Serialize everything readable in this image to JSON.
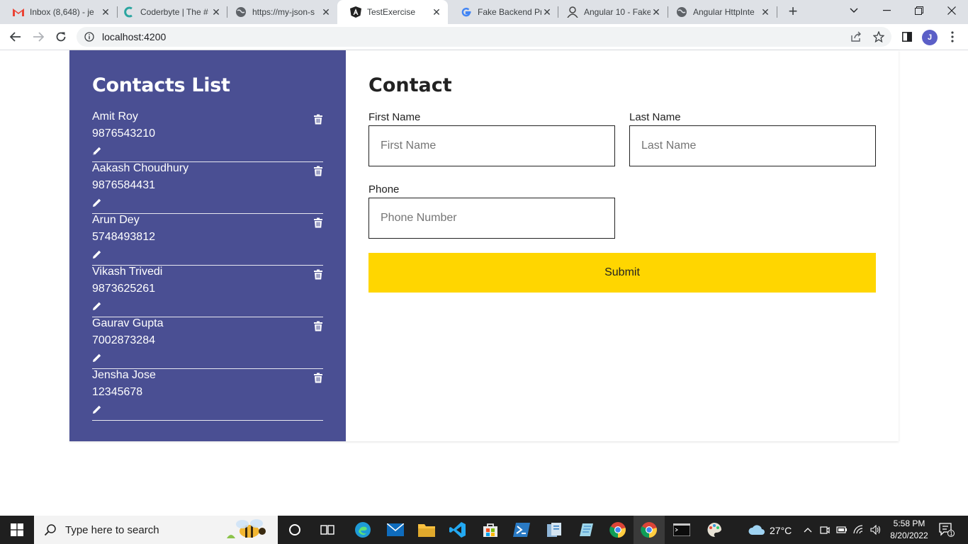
{
  "browser": {
    "tabs": [
      {
        "title": "Inbox (8,648) - je",
        "icon": "gmail-icon",
        "active": false
      },
      {
        "title": "Coderbyte | The #",
        "icon": "coderbyte-icon",
        "active": false
      },
      {
        "title": "https://my-json-s",
        "icon": "globe-icon",
        "active": false
      },
      {
        "title": "TestExercise",
        "icon": "angular-icon",
        "active": true
      },
      {
        "title": "Fake Backend Pro",
        "icon": "google-icon",
        "active": false
      },
      {
        "title": "Angular 10 - Fake",
        "icon": "avatar-icon",
        "active": false
      },
      {
        "title": "Angular HttpInte",
        "icon": "globe-icon",
        "active": false
      }
    ],
    "url": "localhost:4200",
    "profile_initial": "J"
  },
  "sidebar": {
    "title": "Contacts List",
    "contacts": [
      {
        "name": "Amit Roy",
        "phone": "9876543210"
      },
      {
        "name": "Aakash Choudhury",
        "phone": "9876584431"
      },
      {
        "name": "Arun Dey",
        "phone": "5748493812"
      },
      {
        "name": "Vikash Trivedi",
        "phone": "9873625261"
      },
      {
        "name": "Gaurav Gupta",
        "phone": "7002873284"
      },
      {
        "name": "Jensha Jose",
        "phone": "12345678"
      }
    ]
  },
  "form": {
    "title": "Contact",
    "first_name_label": "First Name",
    "first_name_placeholder": "First Name",
    "first_name_value": "",
    "last_name_label": "Last Name",
    "last_name_placeholder": "Last Name",
    "last_name_value": "",
    "phone_label": "Phone",
    "phone_placeholder": "Phone Number",
    "phone_value": "",
    "submit_label": "Submit"
  },
  "taskbar": {
    "search_placeholder": "Type here to search",
    "weather": "27°C",
    "time": "5:58 PM",
    "date": "8/20/2022",
    "notification_count": "1"
  },
  "colors": {
    "sidebar_bg": "#4a4f93",
    "submit_bg": "#ffd600"
  }
}
